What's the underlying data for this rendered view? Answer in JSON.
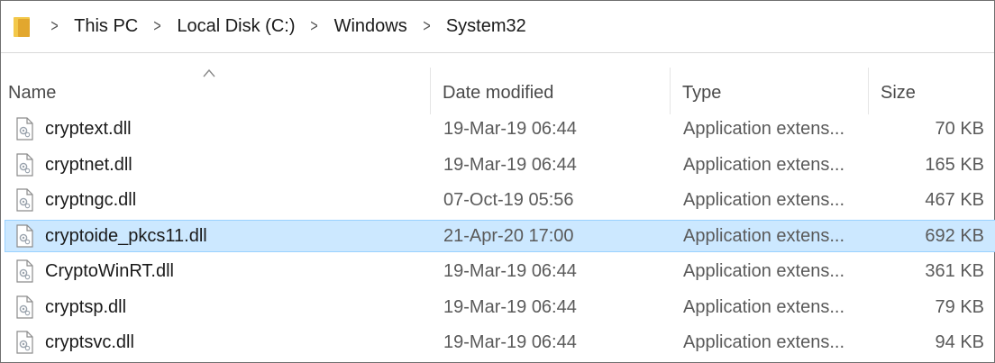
{
  "address_bar": {
    "crumbs": [
      "This PC",
      "Local Disk (C:)",
      "Windows",
      "System32"
    ]
  },
  "columns": {
    "name": "Name",
    "date": "Date modified",
    "type": "Type",
    "size": "Size"
  },
  "files": [
    {
      "name": "cryptext.dll",
      "date": "19-Mar-19 06:44",
      "type": "Application extens...",
      "size": "70 KB",
      "selected": false
    },
    {
      "name": "cryptnet.dll",
      "date": "19-Mar-19 06:44",
      "type": "Application extens...",
      "size": "165 KB",
      "selected": false
    },
    {
      "name": "cryptngc.dll",
      "date": "07-Oct-19 05:56",
      "type": "Application extens...",
      "size": "467 KB",
      "selected": false
    },
    {
      "name": "cryptoide_pkcs11.dll",
      "date": "21-Apr-20 17:00",
      "type": "Application extens...",
      "size": "692 KB",
      "selected": true
    },
    {
      "name": "CryptoWinRT.dll",
      "date": "19-Mar-19 06:44",
      "type": "Application extens...",
      "size": "361 KB",
      "selected": false
    },
    {
      "name": "cryptsp.dll",
      "date": "19-Mar-19 06:44",
      "type": "Application extens...",
      "size": "79 KB",
      "selected": false
    },
    {
      "name": "cryptsvc.dll",
      "date": "19-Mar-19 06:44",
      "type": "Application extens...",
      "size": "94 KB",
      "selected": false
    }
  ],
  "colors": {
    "selection_bg": "#cce8ff",
    "selection_border": "#99d1ff",
    "folder": "#f3c84a"
  },
  "icons": {
    "address_folder": "folder-icon",
    "breadcrumb_separator": "chevron-right-icon",
    "file": "dll-file-icon",
    "sort": "sort-ascending-icon"
  }
}
